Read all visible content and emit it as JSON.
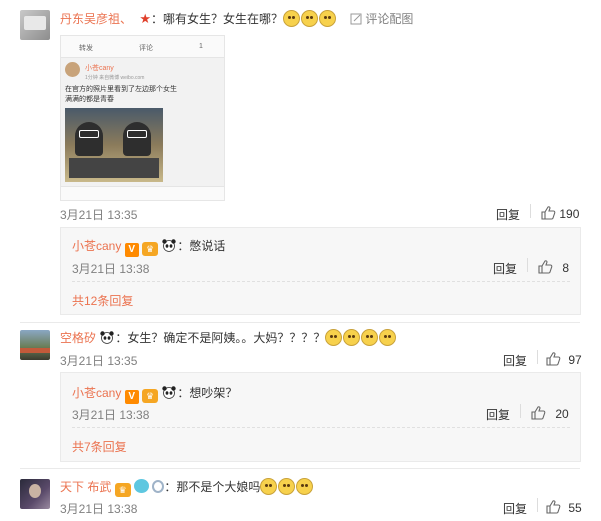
{
  "comments": [
    {
      "user": "丹东吴彦祖、",
      "text": "：哪有女生？女生在哪？",
      "link": "评论配图",
      "time": "3月21日 13:35",
      "reply_label": "回复",
      "likes": "190",
      "embed": {
        "actions": [
          "转发",
          "评论",
          "1"
        ],
        "user": "小苍cany",
        "meta": "1分钟 来自微博 weibo.com",
        "line1": "在官方的照片里看到了左边那个女生",
        "line2": "满满的都是青春"
      },
      "nested": {
        "user": "小苍cany",
        "text": "：憋说话",
        "time": "3月21日 13:38",
        "reply_label": "回复",
        "likes": "8"
      },
      "more": "共12条回复"
    },
    {
      "user": "空格矽",
      "text": "：女生？确定不是阿姨。。大妈？？？？",
      "time": "3月21日 13:35",
      "reply_label": "回复",
      "likes": "97",
      "nested": {
        "user": "小苍cany",
        "text": "：想吵架？",
        "time": "3月21日 13:38",
        "reply_label": "回复",
        "likes": "20"
      },
      "more": "共7条回复"
    },
    {
      "user": "天下 布武",
      "text": "：那不是个大娘吗",
      "time": "3月21日 13:38",
      "reply_label": "回复",
      "likes": "55"
    }
  ],
  "colors": {
    "name": "#eb7350",
    "text": "#333333",
    "time": "#808080",
    "divider": "#eaeaea"
  }
}
